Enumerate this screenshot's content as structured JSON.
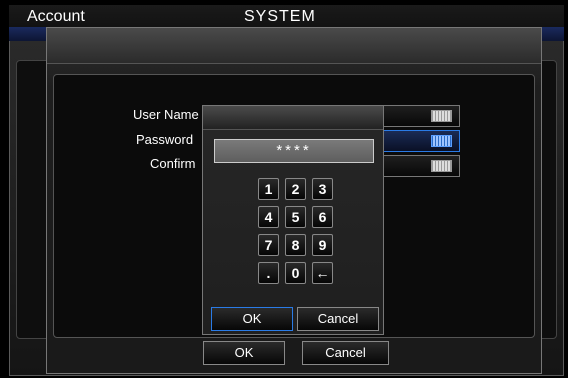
{
  "background_window": {
    "title_left": "Account",
    "title_center": "SYSTEM"
  },
  "dialog": {
    "labels": {
      "user_name": "User Name",
      "password": "Password",
      "confirm": "Confirm"
    },
    "ok_label": "OK",
    "cancel_label": "Cancel"
  },
  "keypad": {
    "display_value": "****",
    "keys": [
      [
        "1",
        "2",
        "3"
      ],
      [
        "4",
        "5",
        "6"
      ],
      [
        "7",
        "8",
        "9"
      ],
      [
        ".",
        "0",
        "←"
      ]
    ],
    "ok_label": "OK",
    "cancel_label": "Cancel"
  },
  "colors": {
    "accent": "#2a7be6",
    "panel": "#1f1f1f"
  },
  "icons": {
    "field_action": "keyboard-icon",
    "backspace": "backspace-arrow"
  }
}
